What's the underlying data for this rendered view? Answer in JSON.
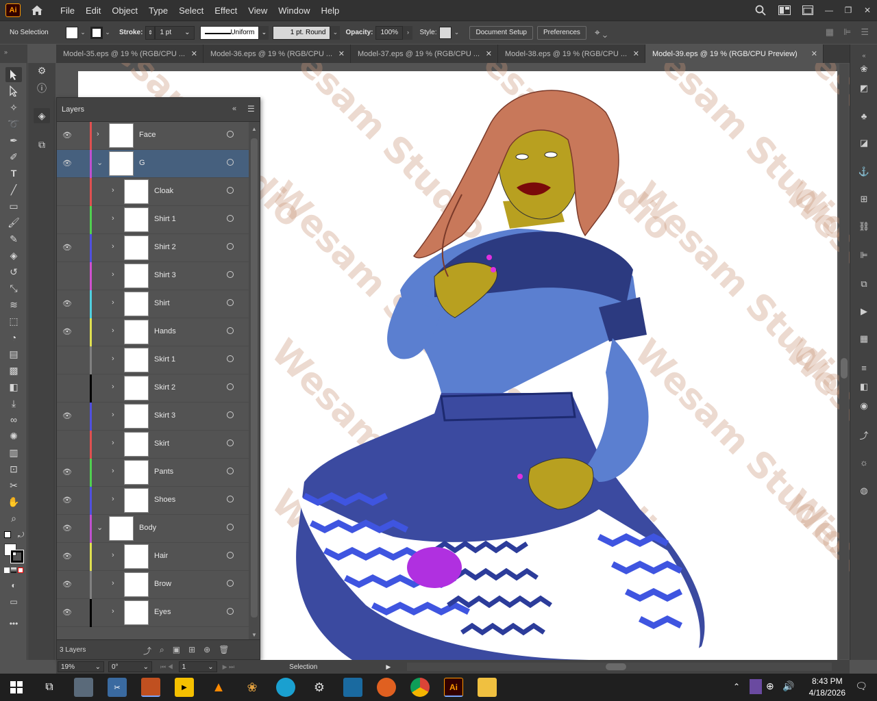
{
  "app": {
    "logo": "Ai",
    "logo_color": "#ff9a00"
  },
  "menu": [
    "File",
    "Edit",
    "Object",
    "Type",
    "Select",
    "Effect",
    "View",
    "Window",
    "Help"
  ],
  "control_bar": {
    "selection": "No Selection",
    "stroke_label": "Stroke:",
    "stroke_weight": "1 pt",
    "stroke_profile": "Uniform",
    "brush": "1 pt. Round",
    "opacity_label": "Opacity:",
    "opacity": "100%",
    "style_label": "Style:",
    "doc_setup": "Document Setup",
    "preferences": "Preferences"
  },
  "tabs": [
    {
      "label": "Model-35.eps @ 19 % (RGB/CPU ..."
    },
    {
      "label": "Model-36.eps @ 19 % (RGB/CPU ..."
    },
    {
      "label": "Model-37.eps @ 19 % (RGB/CPU ..."
    },
    {
      "label": "Model-38.eps @ 19 % (RGB/CPU ..."
    },
    {
      "label": "Model-39.eps @ 19 % (RGB/CPU Preview)"
    }
  ],
  "layers_panel": {
    "title": "Layers",
    "count": "3 Layers",
    "rows": [
      {
        "name": "Face",
        "eye": true,
        "color": "#e05050",
        "level": 0,
        "expanded": false,
        "selected": false
      },
      {
        "name": "G",
        "eye": true,
        "color": "#c050d0",
        "level": 0,
        "expanded": true,
        "selected": true
      },
      {
        "name": "Cloak",
        "eye": false,
        "color": "#e05050",
        "level": 1,
        "expanded": false,
        "selected": false
      },
      {
        "name": "Shirt 1",
        "eye": false,
        "color": "#50d050",
        "level": 1,
        "expanded": false,
        "selected": false
      },
      {
        "name": "Shirt 2",
        "eye": true,
        "color": "#5050e0",
        "level": 1,
        "expanded": false,
        "selected": false
      },
      {
        "name": "Shirt 3",
        "eye": false,
        "color": "#d050d0",
        "level": 1,
        "expanded": false,
        "selected": false
      },
      {
        "name": "Shirt",
        "eye": true,
        "color": "#50d0e0",
        "level": 1,
        "expanded": false,
        "selected": false
      },
      {
        "name": "Hands",
        "eye": true,
        "color": "#e0e050",
        "level": 1,
        "expanded": false,
        "selected": false
      },
      {
        "name": "Skirt 1",
        "eye": false,
        "color": "#808080",
        "level": 1,
        "expanded": false,
        "selected": false
      },
      {
        "name": "Skirt 2",
        "eye": false,
        "color": "#000000",
        "level": 1,
        "expanded": false,
        "selected": false
      },
      {
        "name": "Skirt 3",
        "eye": true,
        "color": "#5050e0",
        "level": 1,
        "expanded": false,
        "selected": false
      },
      {
        "name": "Skirt",
        "eye": false,
        "color": "#e05050",
        "level": 1,
        "expanded": false,
        "selected": false
      },
      {
        "name": "Pants",
        "eye": true,
        "color": "#50d050",
        "level": 1,
        "expanded": false,
        "selected": false
      },
      {
        "name": "Shoes",
        "eye": true,
        "color": "#5050e0",
        "level": 1,
        "expanded": false,
        "selected": false
      },
      {
        "name": "Body",
        "eye": true,
        "color": "#c050d0",
        "level": 0,
        "expanded": true,
        "selected": false
      },
      {
        "name": "Hair",
        "eye": true,
        "color": "#e0e050",
        "level": 1,
        "expanded": false,
        "selected": false
      },
      {
        "name": "Brow",
        "eye": true,
        "color": "#808080",
        "level": 1,
        "expanded": false,
        "selected": false
      },
      {
        "name": "Eyes",
        "eye": true,
        "color": "#000000",
        "level": 1,
        "expanded": false,
        "selected": false
      }
    ]
  },
  "status_bar": {
    "zoom": "19%",
    "rotation": "0°",
    "artboard": "1",
    "mode": "Selection"
  },
  "watermark": "Wesam Studio",
  "taskbar": {
    "time": "8:43 PM",
    "date": "4/18/2026"
  }
}
